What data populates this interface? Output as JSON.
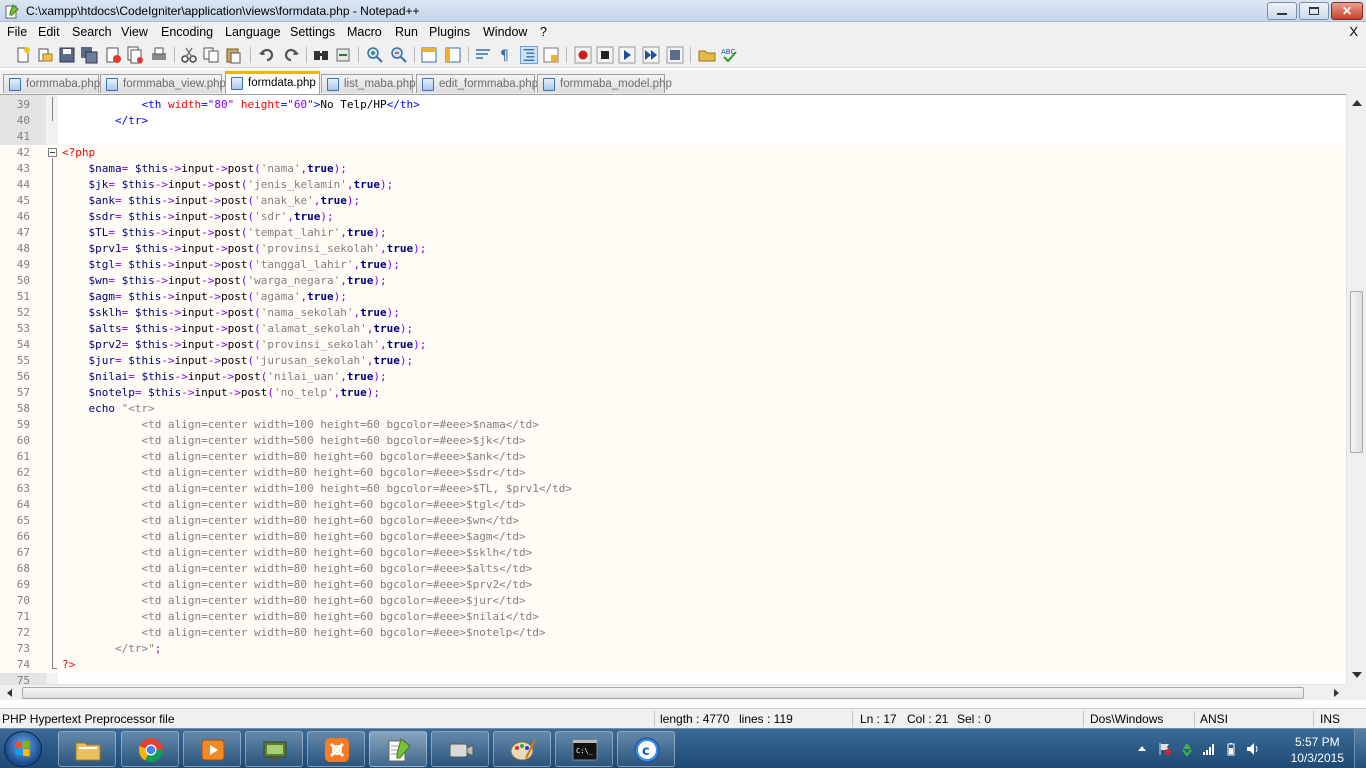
{
  "window": {
    "title": "C:\\xampp\\htdocs\\CodeIgniter\\application\\views\\formdata.php - Notepad++"
  },
  "menu": {
    "items": [
      "File",
      "Edit",
      "Search",
      "View",
      "Encoding",
      "Language",
      "Settings",
      "Macro",
      "Run",
      "Plugins",
      "Window",
      "?"
    ],
    "close": "X"
  },
  "tabs": [
    {
      "label": "formmaba.php",
      "active": false
    },
    {
      "label": "formmaba_view.php",
      "active": false
    },
    {
      "label": "formdata.php",
      "active": true
    },
    {
      "label": "list_maba.php",
      "active": false
    },
    {
      "label": "edit_formmaba.php",
      "active": false
    },
    {
      "label": "formmaba_model.php",
      "active": false
    }
  ],
  "editor": {
    "lines": [
      {
        "n": "39",
        "code": "            <th width=\"80\" height=\"60\">No Telp/HP</th>"
      },
      {
        "n": "40",
        "code": "        </tr>"
      },
      {
        "n": "41",
        "code": ""
      },
      {
        "n": "42",
        "code": "<?php"
      },
      {
        "n": "43",
        "code": "    $nama= $this->input->post('nama',true);"
      },
      {
        "n": "44",
        "code": "    $jk= $this->input->post('jenis_kelamin',true);"
      },
      {
        "n": "45",
        "code": "    $ank= $this->input->post('anak_ke',true);"
      },
      {
        "n": "46",
        "code": "    $sdr= $this->input->post('sdr',true);"
      },
      {
        "n": "47",
        "code": "    $TL= $this->input->post('tempat_lahir',true);"
      },
      {
        "n": "48",
        "code": "    $prv1= $this->input->post('provinsi_sekolah',true);"
      },
      {
        "n": "49",
        "code": "    $tgl= $this->input->post('tanggal_lahir',true);"
      },
      {
        "n": "50",
        "code": "    $wn= $this->input->post('warga_negara',true);"
      },
      {
        "n": "51",
        "code": "    $agm= $this->input->post('agama',true);"
      },
      {
        "n": "52",
        "code": "    $sklh= $this->input->post('nama_sekolah',true);"
      },
      {
        "n": "53",
        "code": "    $alts= $this->input->post('alamat_sekolah',true);"
      },
      {
        "n": "54",
        "code": "    $prv2= $this->input->post('provinsi_sekolah',true);"
      },
      {
        "n": "55",
        "code": "    $jur= $this->input->post('jurusan_sekolah',true);"
      },
      {
        "n": "56",
        "code": "    $nilai= $this->input->post('nilai_uan',true);"
      },
      {
        "n": "57",
        "code": "    $notelp= $this->input->post('no_telp',true);"
      },
      {
        "n": "58",
        "code": "    echo \"<tr>"
      },
      {
        "n": "59",
        "code": "            <td align=center width=100 height=60 bgcolor=#eee>$nama</td>"
      },
      {
        "n": "60",
        "code": "            <td align=center width=500 height=60 bgcolor=#eee>$jk</td>"
      },
      {
        "n": "61",
        "code": "            <td align=center width=80 height=60 bgcolor=#eee>$ank</td>"
      },
      {
        "n": "62",
        "code": "            <td align=center width=80 height=60 bgcolor=#eee>$sdr</td>"
      },
      {
        "n": "63",
        "code": "            <td align=center width=100 height=60 bgcolor=#eee>$TL, $prv1</td>"
      },
      {
        "n": "64",
        "code": "            <td align=center width=80 height=60 bgcolor=#eee>$tgl</td>"
      },
      {
        "n": "65",
        "code": "            <td align=center width=80 height=60 bgcolor=#eee>$wn</td>"
      },
      {
        "n": "66",
        "code": "            <td align=center width=80 height=60 bgcolor=#eee>$agm</td>"
      },
      {
        "n": "67",
        "code": "            <td align=center width=80 height=60 bgcolor=#eee>$sklh</td>"
      },
      {
        "n": "68",
        "code": "            <td align=center width=80 height=60 bgcolor=#eee>$alts</td>"
      },
      {
        "n": "69",
        "code": "            <td align=center width=80 height=60 bgcolor=#eee>$prv2</td>"
      },
      {
        "n": "70",
        "code": "            <td align=center width=80 height=60 bgcolor=#eee>$jur</td>"
      },
      {
        "n": "71",
        "code": "            <td align=center width=80 height=60 bgcolor=#eee>$nilai</td>"
      },
      {
        "n": "72",
        "code": "            <td align=center width=80 height=60 bgcolor=#eee>$notelp</td>"
      },
      {
        "n": "73",
        "code": "        </tr>\";"
      },
      {
        "n": "74",
        "code": "?>"
      },
      {
        "n": "75",
        "code": ""
      }
    ]
  },
  "status": {
    "file_type": "PHP Hypertext Preprocessor file",
    "length": "length : 4770",
    "lines": "lines : 119",
    "ln": "Ln : 17",
    "col": "Col : 21",
    "sel": "Sel : 0",
    "eol": "Dos\\Windows",
    "encoding": "ANSI",
    "mode": "INS"
  },
  "taskbar": {
    "time": "5:57 PM",
    "date": "10/3/2015",
    "apps": [
      "file-explorer",
      "chrome",
      "media-player",
      "network-tool",
      "xampp",
      "notepad-plus-plus",
      "video-app",
      "paint",
      "command-prompt",
      "app-c"
    ]
  },
  "colors": {
    "tag": "#0000ff",
    "attribute": "#ff0000",
    "attr_value": "#8000ff",
    "php_delimiter": "#ff0000",
    "string": "#808080",
    "keyword": "#000080",
    "active_tab_accent": "#f7b500"
  }
}
